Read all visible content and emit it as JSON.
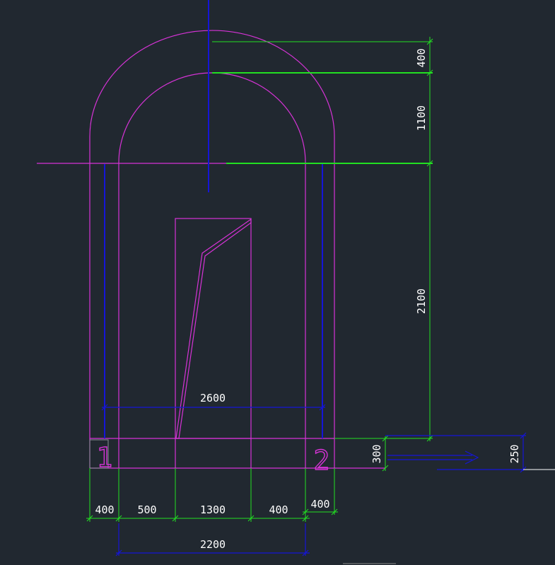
{
  "drawing": {
    "dimensions": {
      "arch_thickness": "400",
      "arch_rise": "1100",
      "wall_height": "2100",
      "opening_width": "2600",
      "base_depth": "300",
      "offset_depth": "250",
      "seg_left_wall": "400",
      "seg_left_gap": "500",
      "seg_window": "1300",
      "seg_right_gap": "400",
      "seg_right_wall": "400",
      "inner_width": "2200"
    },
    "markers": {
      "left": "1",
      "right": "2"
    },
    "colors": {
      "background": "#212830",
      "outline": "#d633d6",
      "dimension": "#22e022",
      "axis": "#1515d8",
      "text": "#ffffff"
    }
  }
}
